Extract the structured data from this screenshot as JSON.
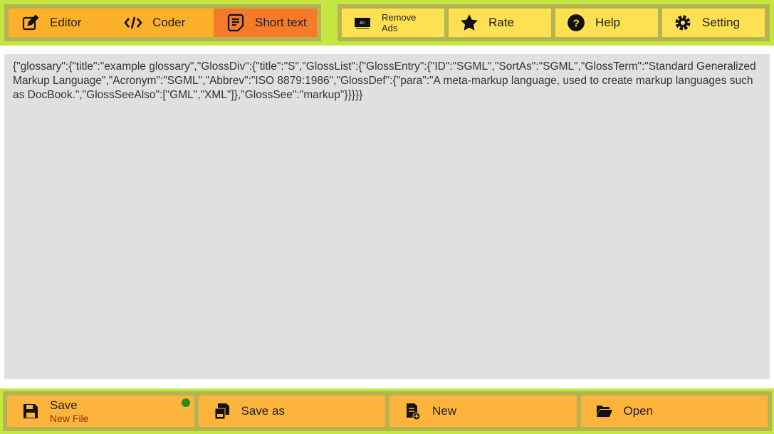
{
  "tabs": [
    {
      "label": "Editor",
      "icon": "edit-icon"
    },
    {
      "label": "Coder",
      "icon": "code-icon"
    },
    {
      "label": "Short text",
      "icon": "note-icon",
      "active": true
    }
  ],
  "actions": [
    {
      "label": "Remove Ads",
      "icon": "ads-icon"
    },
    {
      "label": "Rate",
      "icon": "star-icon"
    },
    {
      "label": "Help",
      "icon": "help-icon"
    },
    {
      "label": "Setting",
      "icon": "gear-icon"
    }
  ],
  "editor": {
    "content": "{\"glossary\":{\"title\":\"example glossary\",\"GlossDiv\":{\"title\":\"S\",\"GlossList\":{\"GlossEntry\":{\"ID\":\"SGML\",\"SortAs\":\"SGML\",\"GlossTerm\":\"Standard Generalized Markup Language\",\"Acronym\":\"SGML\",\"Abbrev\":\"ISO 8879:1986\",\"GlossDef\":{\"para\":\"A meta-markup language, used to create markup languages such as DocBook.\",\"GlossSeeAlso\":[\"GML\",\"XML\"]},\"GlossSee\":\"markup\"}}}}}"
  },
  "bottom": {
    "save": {
      "label": "Save",
      "sub": "New File"
    },
    "save_as": "Save as",
    "new": "New",
    "open": "Open"
  },
  "colors": {
    "background": "#c5e640",
    "tab": "#fdb12b",
    "tab_active": "#f57a2a",
    "action": "#fee152",
    "unsaved_dot": "#2a8a12"
  }
}
